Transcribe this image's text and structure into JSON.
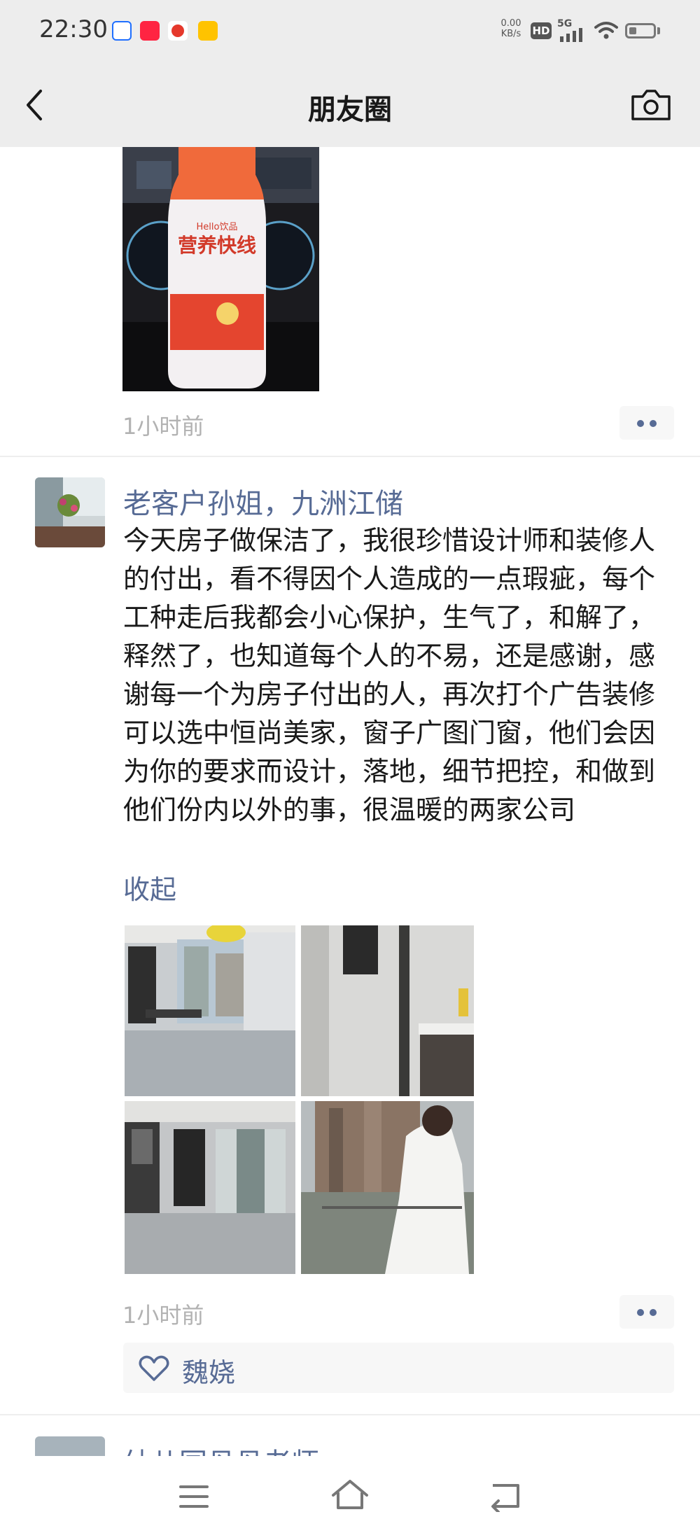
{
  "status_bar": {
    "time": "22:30",
    "app_icons": [
      {
        "name": "app-icon-blue",
        "color": "#1f6fff"
      },
      {
        "name": "xiaohongshu-icon",
        "label": "小红书",
        "color": "#ff2442"
      },
      {
        "name": "app-icon-red",
        "color": "#e5382b"
      },
      {
        "name": "meituan-icon",
        "label": "美团",
        "color": "#ffc300"
      }
    ],
    "net_speed_value": "0.00",
    "net_speed_unit": "KB/s",
    "hd_label": "HD",
    "signal_label": "5G",
    "battery_level": 0.3
  },
  "nav": {
    "title": "朋友圈",
    "back_icon": "chevron-left-icon",
    "camera_icon": "camera-icon"
  },
  "feed": {
    "post1": {
      "image_desc_bottle_brand": "Hello饮品",
      "image_bottle_text": "营养快线",
      "time": "1小时前"
    },
    "post2": {
      "author": "老客户孙姐，九洲江储",
      "text": "今天房子做保洁了，我很珍惜设计师和装修人的付出，看不得因个人造成的一点瑕疵，每个工种走后我都会小心保护，生气了，和解了，释然了，也知道每个人的不易，还是感谢，感谢每一个为房子付出的人，再次打个广告装修可以选中恒尚美家，窗子广图门窗，他们会因为你的要求而设计，落地，细节把控，和做到他们份内以外的事，很温暖的两家公司",
      "collapse_label": "收起",
      "time": "1小时前",
      "likes": "魏娆"
    },
    "post3": {
      "author_partial": "幼儿园丹丹老师"
    }
  },
  "colors": {
    "accent": "#576b95",
    "bar_bg": "#ededed",
    "meta_grey": "#b2b2b2"
  }
}
